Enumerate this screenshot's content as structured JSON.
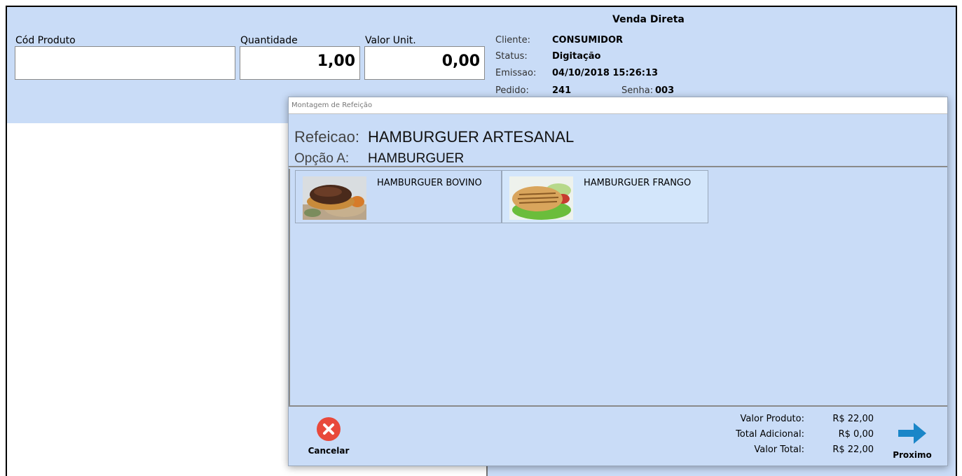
{
  "form": {
    "cod_produto_label": "Cód Produto",
    "cod_produto_value": "",
    "quantidade_label": "Quantidade",
    "quantidade_value": "1,00",
    "valor_unit_label": "Valor Unit.",
    "valor_unit_value": "0,00"
  },
  "header": {
    "title": "Venda Direta",
    "cliente_label": "Cliente:",
    "cliente_value": "CONSUMIDOR",
    "status_label": "Status:",
    "status_value": "Digitação",
    "emissao_label": "Emissao:",
    "emissao_value": "04/10/2018 15:26:13",
    "pedido_label": "Pedido:",
    "pedido_value": "241",
    "senha_label": "Senha:",
    "senha_value": "003"
  },
  "modal": {
    "title": "Montagem de Refeição",
    "refeicao_label": "Refeicao:",
    "refeicao_value": "HAMBURGUER ARTESANAL",
    "opcao_label": "Opção A:",
    "opcao_value": "HAMBURGUER",
    "items": [
      {
        "name": "HAMBURGUER BOVINO",
        "image": "beef-burger-photo"
      },
      {
        "name": "HAMBURGUER FRANGO",
        "image": "chicken-burger-photo"
      }
    ],
    "cancel_label": "Cancelar",
    "next_label": "Proximo",
    "valor_produto_label": "Valor Produto:",
    "valor_produto_value": "R$ 22,00",
    "total_adicional_label": "Total Adicional:",
    "total_adicional_value": "R$ 0,00",
    "valor_total_label": "Valor Total:",
    "valor_total_value": "R$ 22,00"
  },
  "colors": {
    "panel": "#c9dcf7",
    "cancel": "#e8493b",
    "next_arrow": "#1a86c8"
  }
}
